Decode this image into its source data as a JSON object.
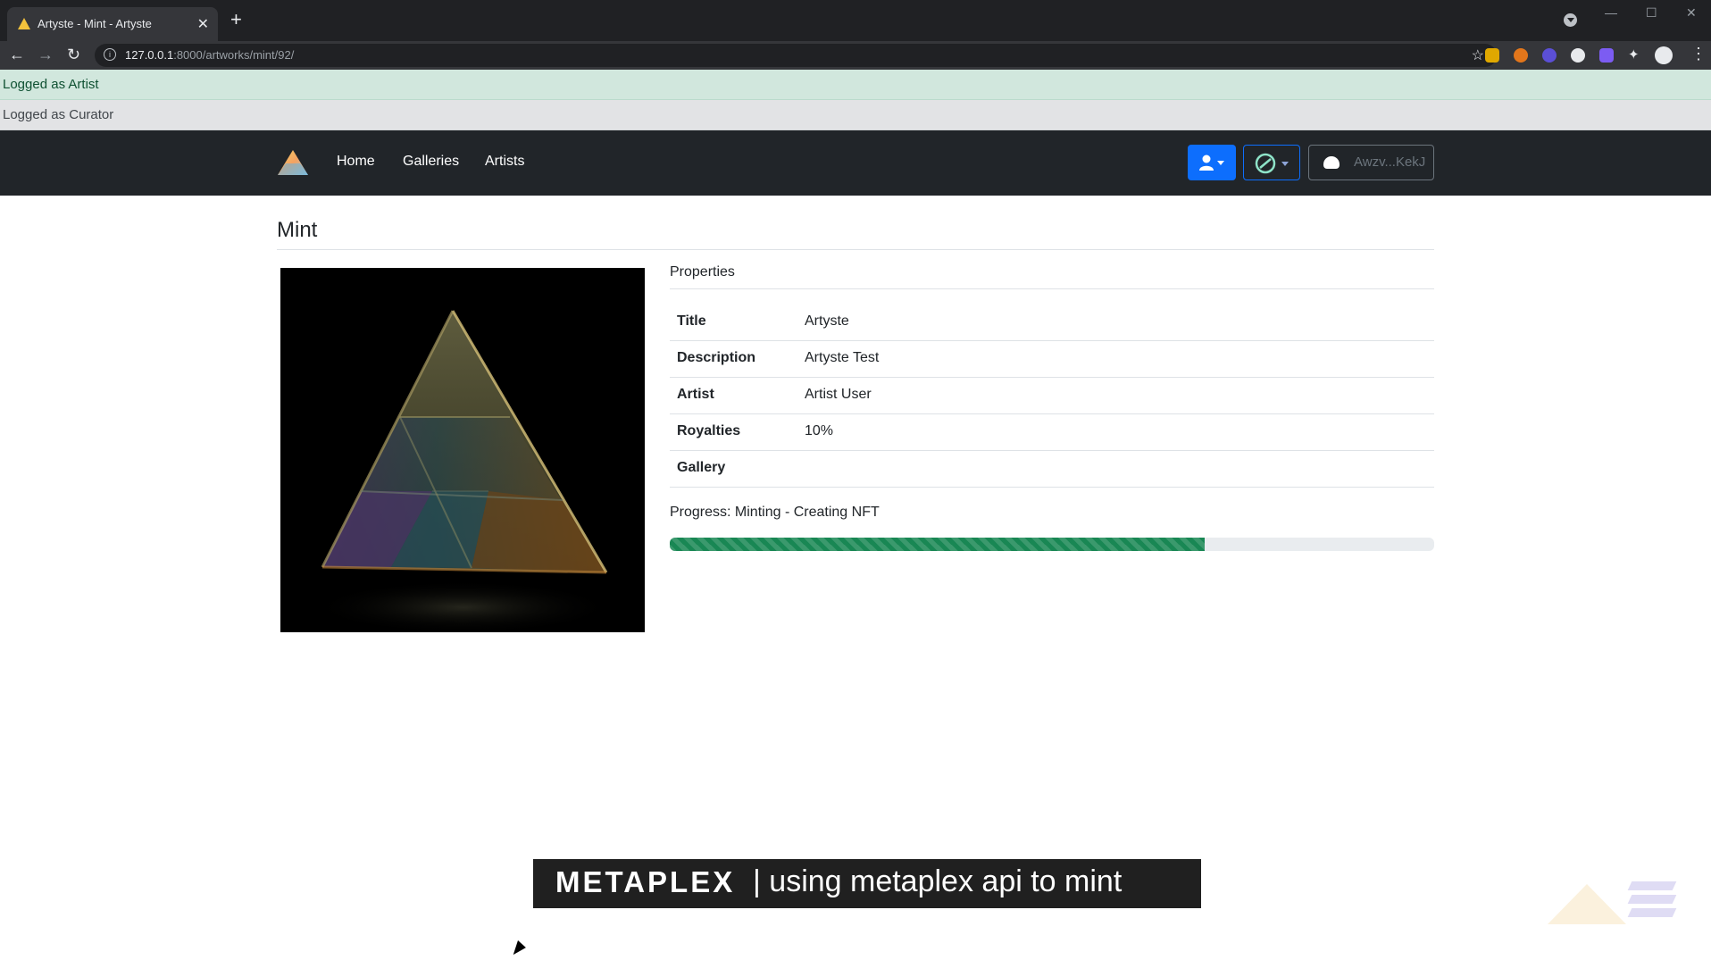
{
  "browser": {
    "tab_title": "Artyste - Mint - Artyste",
    "tab_close": "✕",
    "new_tab": "+",
    "url_host": "127.0.0.1",
    "url_rest": ":8000/artworks/mint/92/",
    "win_min": "—",
    "win_max": "☐",
    "win_close": "✕"
  },
  "alerts": {
    "artist": "Logged as Artist",
    "curator": "Logged as Curator"
  },
  "nav": {
    "home": "Home",
    "galleries": "Galleries",
    "artists": "Artists",
    "wallet_address": "Awzv...KekJ"
  },
  "page": {
    "title": "Mint",
    "properties_title": "Properties"
  },
  "properties": [
    {
      "key": "Title",
      "value": "Artyste"
    },
    {
      "key": "Description",
      "value": "Artyste Test"
    },
    {
      "key": "Artist",
      "value": "Artist User"
    },
    {
      "key": "Royalties",
      "value": "10%"
    },
    {
      "key": "Gallery",
      "value": ""
    }
  ],
  "progress": {
    "label": "Progress: Minting - Creating NFT",
    "percent": 70,
    "color": "#198754"
  },
  "caption": {
    "brand": "METAPLEX",
    "text": "| using metaplex api to mint"
  },
  "colors": {
    "navbar": "#212529",
    "primary": "#0d6efd",
    "success_alert": "#d1e7dd",
    "secondary_alert": "#e2e3e5"
  }
}
